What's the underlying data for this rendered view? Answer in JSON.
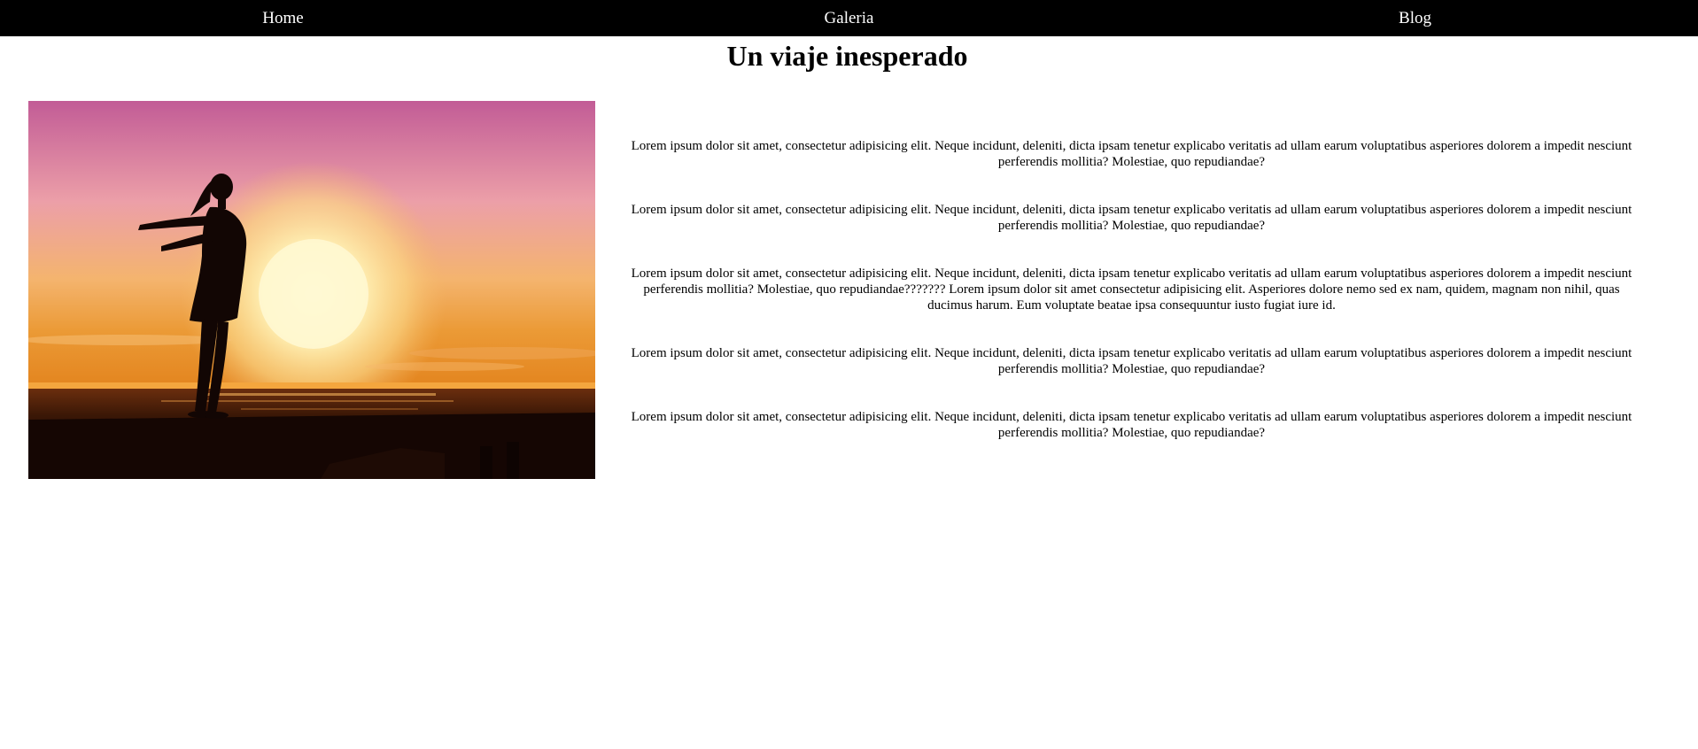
{
  "nav": {
    "items": [
      {
        "label": "Home"
      },
      {
        "label": "Galeria"
      },
      {
        "label": "Blog"
      }
    ]
  },
  "header": {
    "title": "Un viaje inesperado"
  },
  "hero": {
    "alt": "Silhouette of a woman with open arms at sunset by the sea",
    "colors": {
      "sky_top": "#c25c96",
      "sky_mid": "#f2b07a",
      "sun": "#fff6c4",
      "horizon": "#e9922a",
      "sea": "#2a1208",
      "silhouette": "#120604"
    }
  },
  "content": {
    "paragraphs": [
      "Lorem ipsum dolor sit amet, consectetur adipisicing elit. Neque incidunt, deleniti, dicta ipsam tenetur explicabo veritatis ad ullam earum voluptatibus asperiores dolorem a impedit nesciunt perferendis mollitia? Molestiae, quo repudiandae?",
      "Lorem ipsum dolor sit amet, consectetur adipisicing elit. Neque incidunt, deleniti, dicta ipsam tenetur explicabo veritatis ad ullam earum voluptatibus asperiores dolorem a impedit nesciunt perferendis mollitia? Molestiae, quo repudiandae?",
      "Lorem ipsum dolor sit amet, consectetur adipisicing elit. Neque incidunt, deleniti, dicta ipsam tenetur explicabo veritatis ad ullam earum voluptatibus asperiores dolorem a impedit nesciunt perferendis mollitia? Molestiae, quo repudiandae??????? Lorem ipsum dolor sit amet consectetur adipisicing elit. Asperiores dolore nemo sed ex nam, quidem, magnam non nihil, quas ducimus harum. Eum voluptate beatae ipsa consequuntur iusto fugiat iure id.",
      "Lorem ipsum dolor sit amet, consectetur adipisicing elit. Neque incidunt, deleniti, dicta ipsam tenetur explicabo veritatis ad ullam earum voluptatibus asperiores dolorem a impedit nesciunt perferendis mollitia? Molestiae, quo repudiandae?",
      "Lorem ipsum dolor sit amet, consectetur adipisicing elit. Neque incidunt, deleniti, dicta ipsam tenetur explicabo veritatis ad ullam earum voluptatibus asperiores dolorem a impedit nesciunt perferendis mollitia? Molestiae, quo repudiandae?"
    ]
  }
}
